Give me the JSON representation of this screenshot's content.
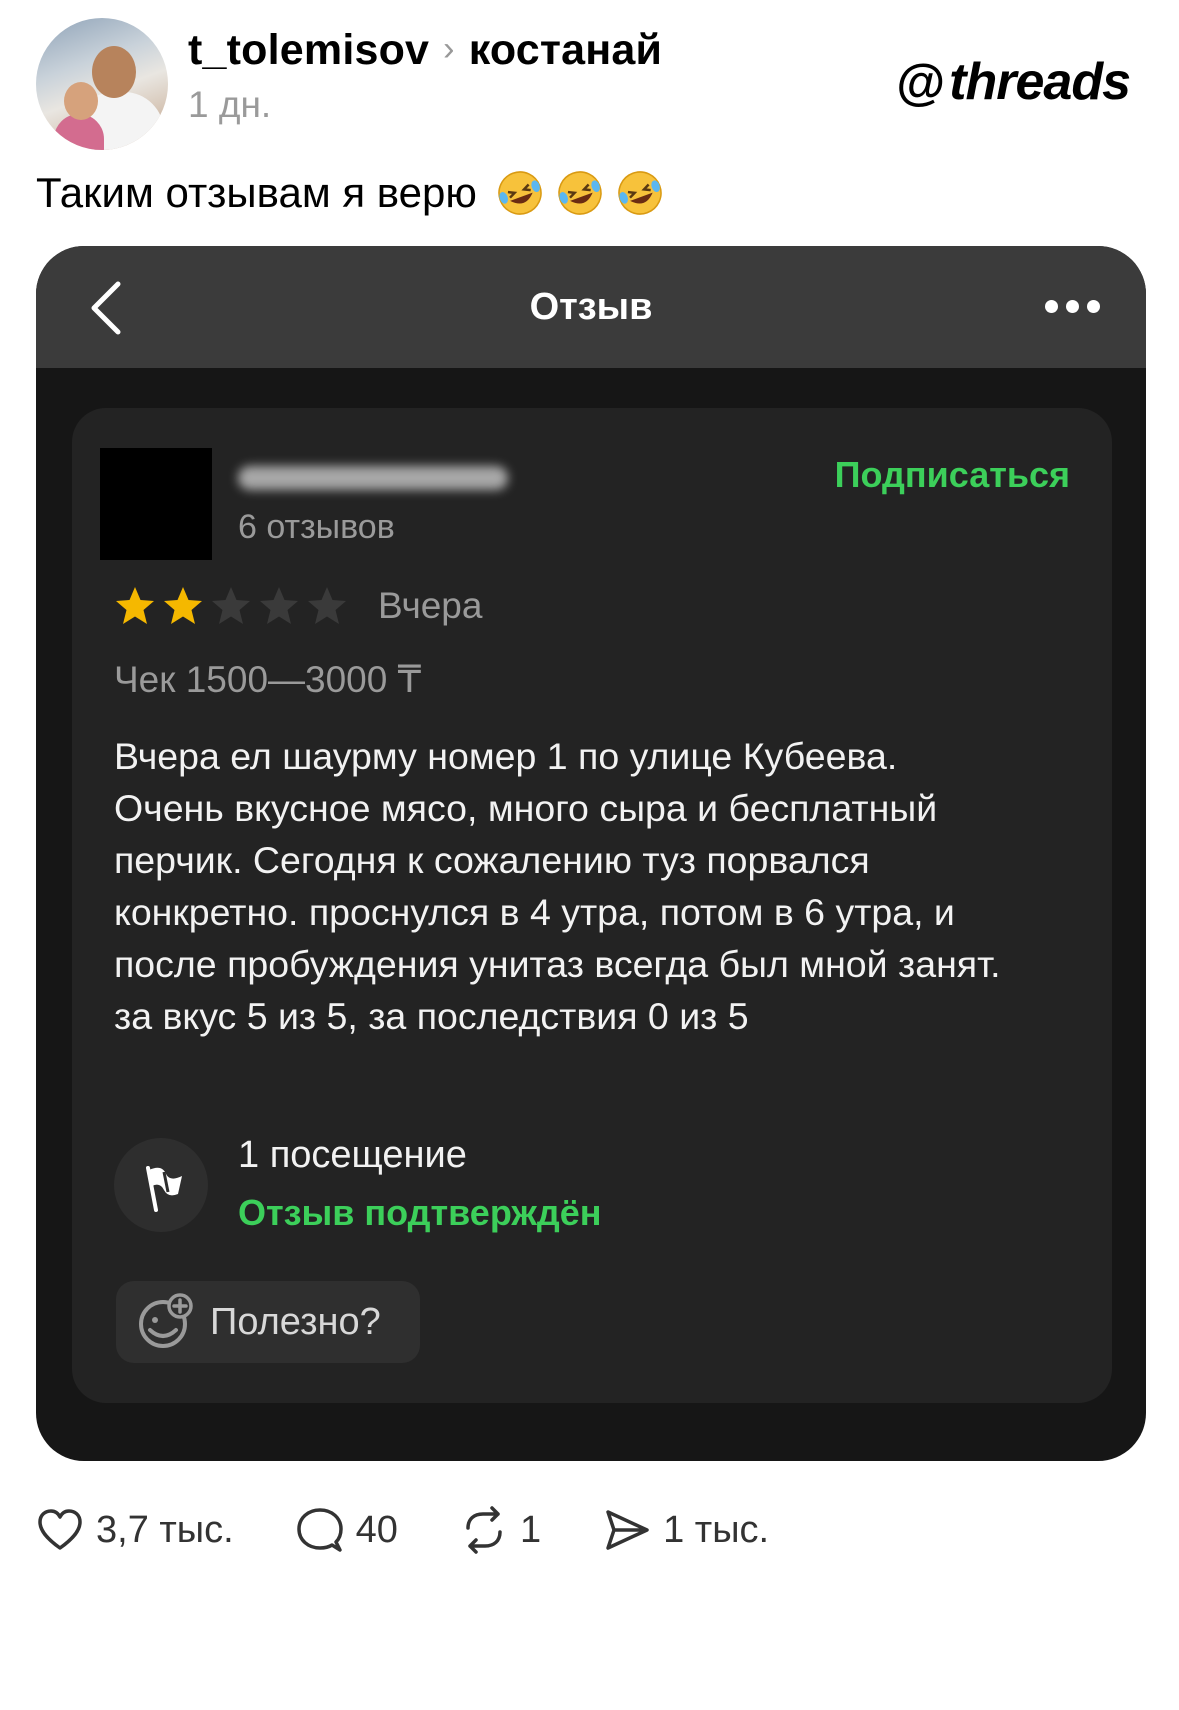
{
  "post": {
    "username": "t_tolemisov",
    "separator": "›",
    "topic": "костанай",
    "time": "1 дн.",
    "brand": "threads",
    "text": "Таким отзывам я верю",
    "emoji": [
      "rolling-on-floor-laughing",
      "rolling-on-floor-laughing",
      "rolling-on-floor-laughing"
    ]
  },
  "screenshot": {
    "title": "Отзыв",
    "review": {
      "review_count": "6 отзывов",
      "subscribe_label": "Подписаться",
      "rating": 2,
      "rating_max": 5,
      "date": "Вчера",
      "check": "Чек 1500—3000 ₸",
      "body": "Вчера ел шаурму номер 1 по улице Кубеева. Очень вкусное мясо, много сыра и бесплатный перчик. Сегодня к сожалению туз порвался конкретно. проснулся в 4 утра, потом в 6 утра, и после пробуждения унитаз всегда был мной занят. за вкус 5 из 5, за последствия 0 из 5",
      "visits": "1 посещение",
      "confirmed": "Отзыв подтверждён",
      "useful_label": "Полезно?"
    },
    "colors": {
      "accent_green": "#3ccf5a",
      "star_gold": "#f5b800",
      "background": "#161616"
    }
  },
  "actions": {
    "likes": "3,7 тыс.",
    "comments": "40",
    "reposts": "1",
    "shares": "1 тыс."
  }
}
